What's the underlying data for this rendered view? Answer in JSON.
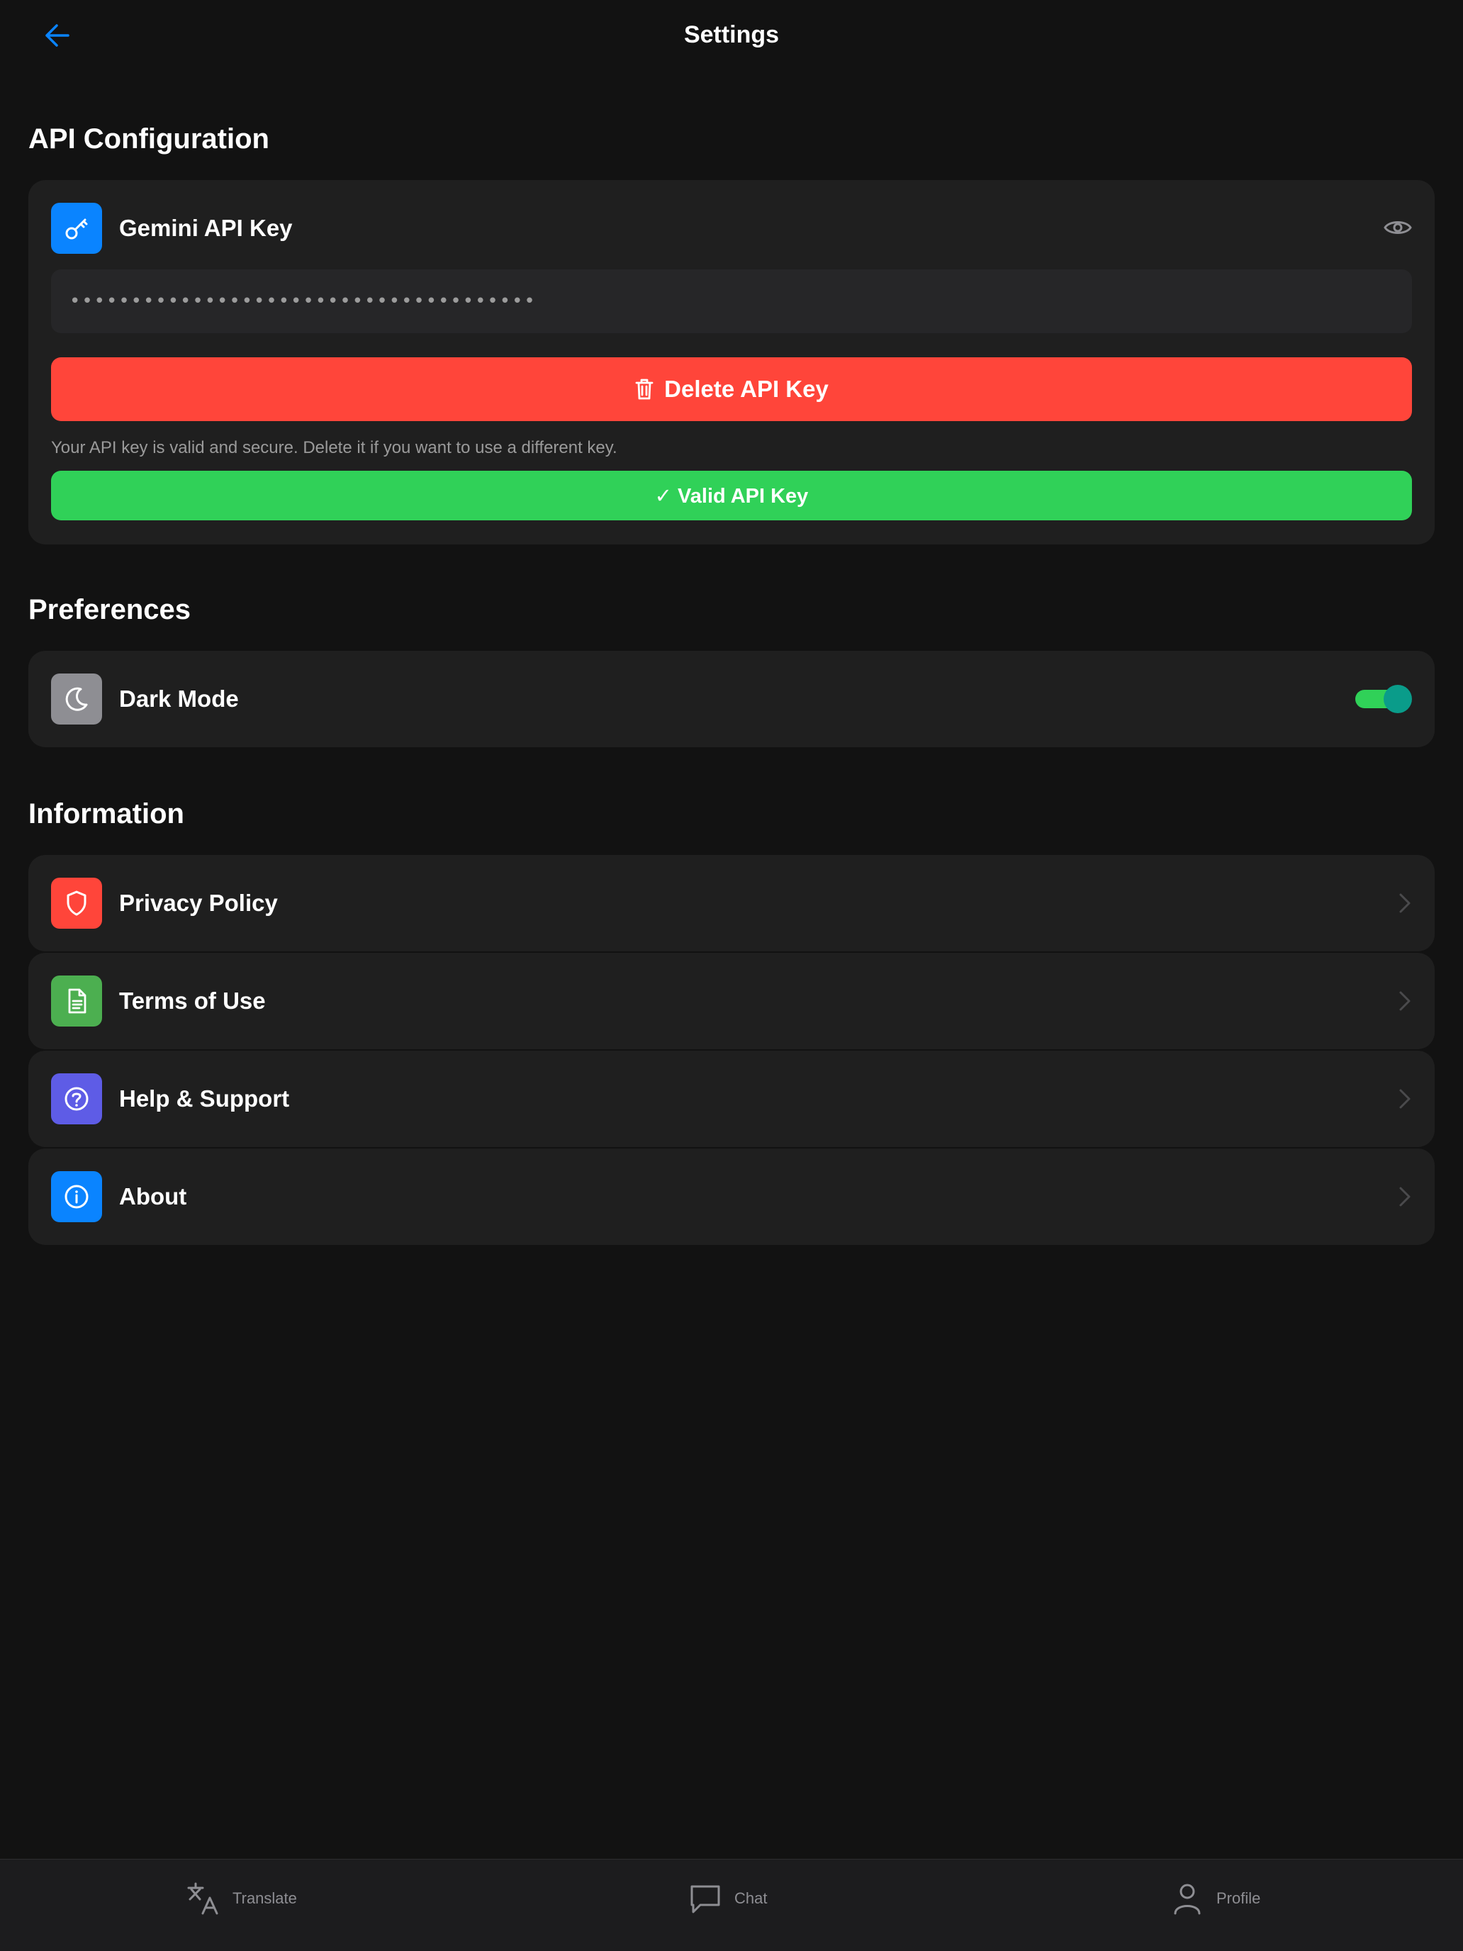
{
  "header": {
    "title": "Settings"
  },
  "sections": {
    "api": "API Configuration",
    "preferences": "Preferences",
    "information": "Information"
  },
  "api_card": {
    "label": "Gemini API Key",
    "masked_value": "••••••••••••••••••••••••••••••••••••••",
    "delete_label": "Delete API Key",
    "helper": "Your API key is valid and secure. Delete it if you want to use a different key.",
    "valid_label": "✓ Valid API Key"
  },
  "preferences": {
    "dark_mode_label": "Dark Mode",
    "dark_mode_on": true
  },
  "information": {
    "privacy": "Privacy Policy",
    "terms": "Terms of Use",
    "help": "Help & Support",
    "about": "About"
  },
  "nav": {
    "translate": "Translate",
    "chat": "Chat",
    "profile": "Profile"
  },
  "colors": {
    "accent_blue": "#0a84ff",
    "danger": "#ff453a",
    "success": "#30d158",
    "gray_icon": "#8e8e93",
    "green_icon": "#4caf50",
    "purple_icon": "#5e5ce6"
  },
  "icons": {
    "back": "arrow-left-icon",
    "key": "key-icon",
    "eye": "eye-icon",
    "trash": "trash-icon",
    "moon": "moon-icon",
    "shield": "shield-icon",
    "document": "document-icon",
    "help": "question-circle-icon",
    "info": "info-circle-icon",
    "chevron": "chevron-right-icon",
    "translate": "translate-icon",
    "chat": "chat-bubble-icon",
    "profile": "person-icon"
  }
}
